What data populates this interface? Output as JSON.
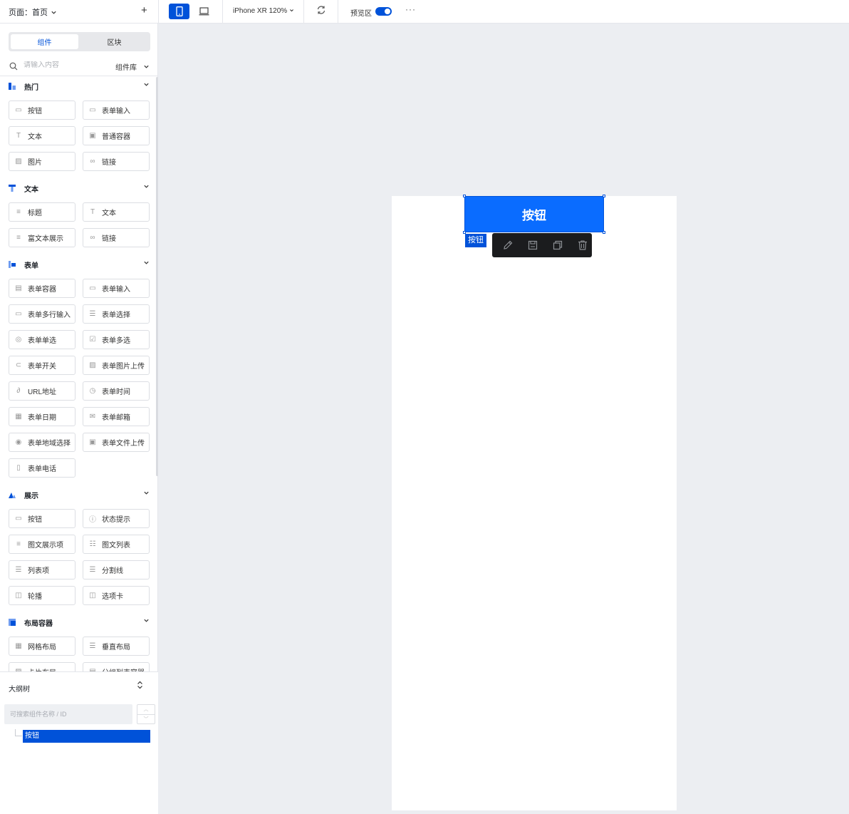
{
  "topbar": {
    "page_label": "页面：首页",
    "device_label": "iPhone XR 120%",
    "preview_label": "预览区",
    "preview_on": true
  },
  "sidebar": {
    "tabs": [
      {
        "label": "组件",
        "active": true
      },
      {
        "label": "区块",
        "active": false
      }
    ],
    "search_placeholder": "请输入内容",
    "library_label": "组件库",
    "categories": [
      {
        "title": "热门",
        "items": [
          {
            "label": "按钮",
            "icon": "button-icon"
          },
          {
            "label": "表单输入",
            "icon": "input-icon"
          },
          {
            "label": "文本",
            "icon": "text-icon"
          },
          {
            "label": "普通容器",
            "icon": "container-icon"
          },
          {
            "label": "图片",
            "icon": "image-icon"
          },
          {
            "label": "链接",
            "icon": "link-icon"
          }
        ]
      },
      {
        "title": "文本",
        "items": [
          {
            "label": "标题",
            "icon": "heading-icon"
          },
          {
            "label": "文本",
            "icon": "text-icon"
          },
          {
            "label": "富文本展示",
            "icon": "rich-text-icon"
          },
          {
            "label": "链接",
            "icon": "link-icon"
          }
        ]
      },
      {
        "title": "表单",
        "items": [
          {
            "label": "表单容器",
            "icon": "form-container-icon"
          },
          {
            "label": "表单输入",
            "icon": "input-icon"
          },
          {
            "label": "表单多行输入",
            "icon": "textarea-icon"
          },
          {
            "label": "表单选择",
            "icon": "select-icon"
          },
          {
            "label": "表单单选",
            "icon": "radio-icon"
          },
          {
            "label": "表单多选",
            "icon": "checkbox-icon"
          },
          {
            "label": "表单开关",
            "icon": "switch-icon"
          },
          {
            "label": "表单图片上传",
            "icon": "image-upload-icon"
          },
          {
            "label": "URL地址",
            "icon": "url-icon"
          },
          {
            "label": "表单时间",
            "icon": "clock-icon"
          },
          {
            "label": "表单日期",
            "icon": "calendar-icon"
          },
          {
            "label": "表单邮箱",
            "icon": "mail-icon"
          },
          {
            "label": "表单地域选择",
            "icon": "location-icon"
          },
          {
            "label": "表单文件上传",
            "icon": "file-upload-icon"
          },
          {
            "label": "表单电话",
            "icon": "phone-icon"
          }
        ]
      },
      {
        "title": "展示",
        "items": [
          {
            "label": "按钮",
            "icon": "button-icon"
          },
          {
            "label": "状态提示",
            "icon": "info-icon"
          },
          {
            "label": "图文展示项",
            "icon": "media-item-icon"
          },
          {
            "label": "图文列表",
            "icon": "media-list-icon"
          },
          {
            "label": "列表项",
            "icon": "list-icon"
          },
          {
            "label": "分割线",
            "icon": "divider-icon"
          },
          {
            "label": "轮播",
            "icon": "carousel-icon"
          },
          {
            "label": "选项卡",
            "icon": "tabs-icon"
          }
        ]
      },
      {
        "title": "布局容器",
        "items": [
          {
            "label": "网格布局",
            "icon": "grid-icon"
          },
          {
            "label": "垂直布局",
            "icon": "vertical-layout-icon"
          },
          {
            "label": "卡片布局",
            "icon": "card-icon"
          },
          {
            "label": "分组列表容器",
            "icon": "group-list-icon"
          }
        ]
      }
    ]
  },
  "outline": {
    "title": "大纲树",
    "search_placeholder": "可搜索组件名称 / ID",
    "nodes": [
      {
        "label": "按钮",
        "selected": true
      }
    ]
  },
  "canvas": {
    "button_label": "按钮",
    "selection_tag": "按钮",
    "toolbar": [
      "edit-icon",
      "save-icon",
      "copy-icon",
      "delete-icon"
    ],
    "accent": "#0052d9",
    "button_color": "#0a6cff"
  }
}
